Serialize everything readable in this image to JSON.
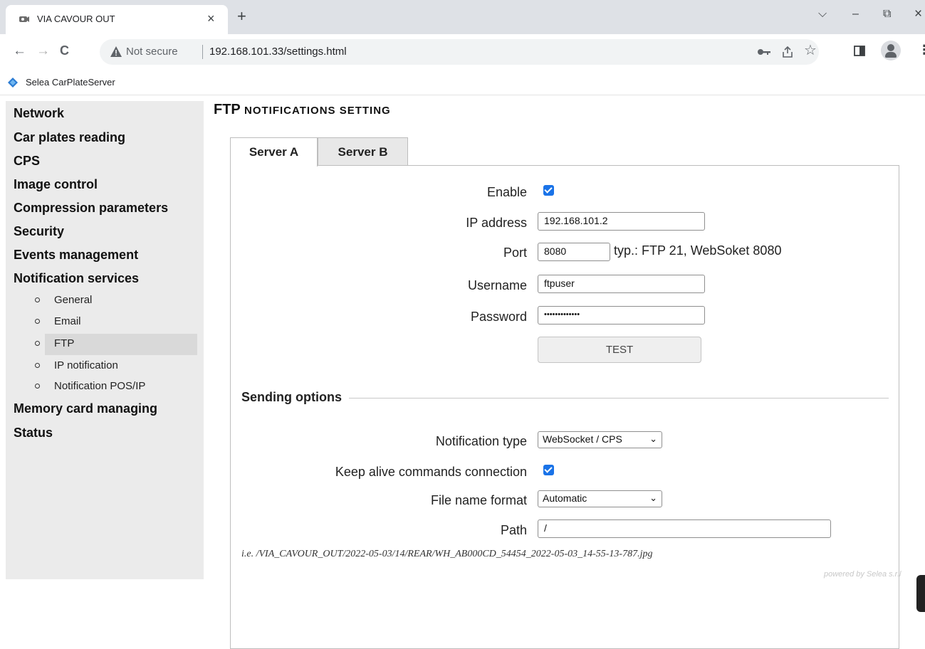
{
  "browser": {
    "tab_title": "VIA CAVOUR OUT",
    "tab_close": "×",
    "new_tab": "+",
    "window_controls": {
      "dropdown": "⌵",
      "minimize": "–",
      "restore": "⧉",
      "close": "×"
    },
    "nav": {
      "back": "←",
      "forward": "→",
      "reload": "C"
    },
    "security_label": "Not secure",
    "url": "192.168.101.33/settings.html",
    "toolbar_icons": [
      "key-icon",
      "share-icon",
      "star-icon",
      "side-panel-icon",
      "profile-icon",
      "menu-icon"
    ],
    "bookmark": {
      "label": "Selea CarPlateServer",
      "icon_color": "#2b7cd3"
    }
  },
  "sidebar": {
    "menu": [
      {
        "label": "Network"
      },
      {
        "label": "Car plates reading"
      },
      {
        "label": "CPS"
      },
      {
        "label": "Image control"
      },
      {
        "label": "Compression parameters"
      },
      {
        "label": "Security"
      },
      {
        "label": "Events management"
      },
      {
        "label": "Notification services"
      }
    ],
    "submenu": [
      {
        "label": "General"
      },
      {
        "label": "Email"
      },
      {
        "label": "FTP",
        "active": true
      },
      {
        "label": "IP notification"
      },
      {
        "label": "Notification POS/IP"
      }
    ],
    "menu_after": [
      {
        "label": "Memory card managing"
      },
      {
        "label": "Status"
      }
    ]
  },
  "page": {
    "title_prefix": "FTP",
    "title_suffix": "NOTIFICATIONS SETTING",
    "tabs": [
      {
        "label": "Server A",
        "active": true
      },
      {
        "label": "Server B"
      }
    ],
    "form": {
      "enable_label": "Enable",
      "enable_checked": true,
      "ip_label": "IP address",
      "ip_value": "192.168.101.2",
      "port_label": "Port",
      "port_value": "8080",
      "port_hint": "typ.: FTP 21, WebSoket 8080",
      "username_label": "Username",
      "username_value": "ftpuser",
      "password_label": "Password",
      "password_value": "•••••••••••••",
      "test_button": "TEST"
    },
    "sending": {
      "title": "Sending options",
      "notif_type_label": "Notification type",
      "notif_type_value": "WebSocket / CPS",
      "keepalive_label": "Keep alive commands connection",
      "keepalive_checked": true,
      "filename_label": "File name format",
      "filename_value": "Automatic",
      "path_label": "Path",
      "path_value": "/",
      "example": "i.e. /VIA_CAVOUR_OUT/2022-05-03/14/REAR/WH_AB000CD_54454_2022-05-03_14-55-13-787.jpg"
    },
    "powered_by": "powered by Selea s.r.l",
    "accent_color": "#1a73e8"
  }
}
